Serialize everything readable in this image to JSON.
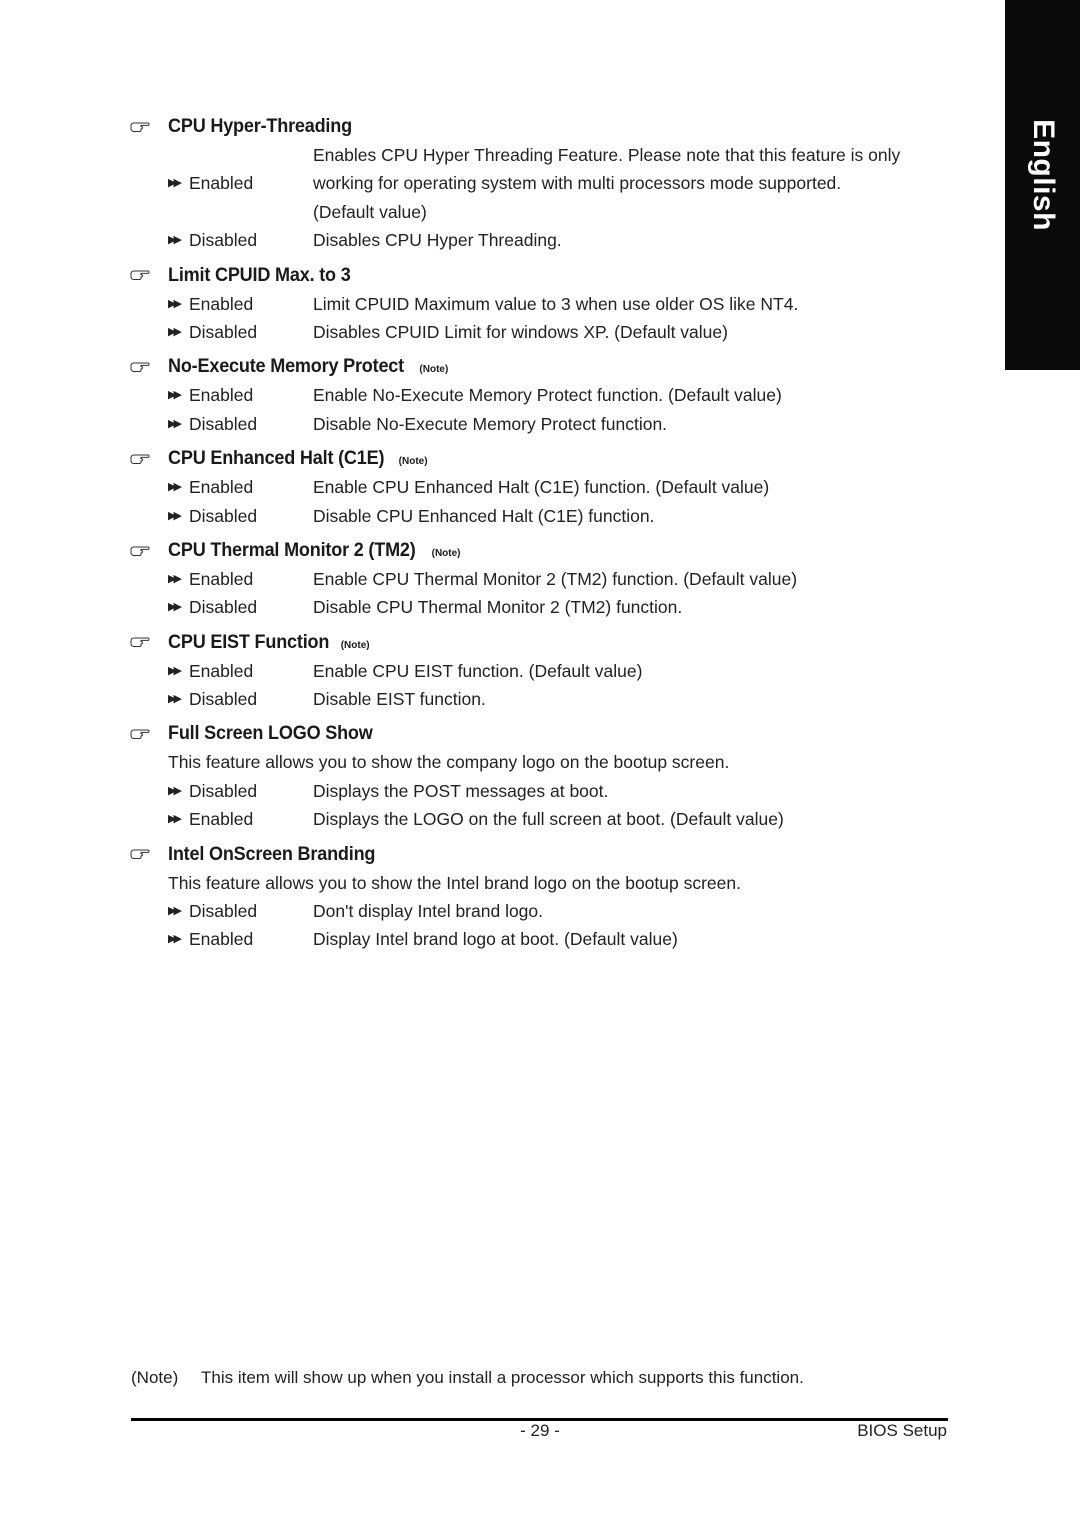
{
  "side_tab": {
    "label": "English"
  },
  "sections": [
    {
      "title": "CPU Hyper-Threading",
      "note_mark": "",
      "intro": "",
      "options": [
        {
          "label": "Enabled",
          "desc": [
            "Enables CPU Hyper Threading Feature. Please note that this feature is only",
            "working for operating system with multi processors mode supported.",
            "(Default value)"
          ]
        },
        {
          "label": "Disabled",
          "desc": [
            "Disables CPU Hyper Threading."
          ]
        }
      ]
    },
    {
      "title": "Limit CPUID Max. to 3",
      "note_mark": "",
      "intro": "",
      "options": [
        {
          "label": "Enabled",
          "desc": [
            "Limit CPUID Maximum value to 3 when use older OS like NT4."
          ]
        },
        {
          "label": "Disabled",
          "desc": [
            "Disables CPUID Limit for windows XP. (Default value)"
          ]
        }
      ]
    },
    {
      "title": "No-Execute Memory Protect",
      "note_mark": "(Note)",
      "intro": "",
      "options": [
        {
          "label": "Enabled",
          "desc": [
            "Enable No-Execute Memory Protect function. (Default value)"
          ]
        },
        {
          "label": "Disabled",
          "desc": [
            "Disable No-Execute Memory Protect function."
          ]
        }
      ]
    },
    {
      "title": "CPU Enhanced Halt (C1E)",
      "note_mark": "(Note)",
      "intro": "",
      "options": [
        {
          "label": "Enabled",
          "desc": [
            "Enable CPU Enhanced Halt (C1E) function. (Default value)"
          ]
        },
        {
          "label": "Disabled",
          "desc": [
            "Disable CPU Enhanced Halt (C1E) function."
          ]
        }
      ]
    },
    {
      "title": "CPU Thermal Monitor 2 (TM2)",
      "note_mark": "(Note)",
      "intro": "",
      "options": [
        {
          "label": "Enabled",
          "desc": [
            "Enable CPU Thermal Monitor 2 (TM2) function. (Default value)"
          ]
        },
        {
          "label": "Disabled",
          "desc": [
            "Disable CPU Thermal Monitor 2 (TM2) function."
          ]
        }
      ]
    },
    {
      "title": "CPU EIST Function",
      "note_mark": "(Note)",
      "intro": "",
      "options": [
        {
          "label": "Enabled",
          "desc": [
            "Enable CPU EIST function. (Default value)"
          ]
        },
        {
          "label": "Disabled",
          "desc": [
            "Disable EIST function."
          ]
        }
      ]
    },
    {
      "title": "Full Screen LOGO Show",
      "note_mark": "",
      "intro": "This feature allows you to show the company logo on the bootup screen.",
      "options": [
        {
          "label": "Disabled",
          "desc": [
            "Displays the POST messages at boot."
          ]
        },
        {
          "label": "Enabled",
          "desc": [
            "Displays the LOGO on the full screen at boot. (Default value)"
          ]
        }
      ]
    },
    {
      "title": "Intel OnScreen Branding",
      "note_mark": "",
      "intro": "This feature allows you to show the Intel brand logo on the bootup screen.",
      "options": [
        {
          "label": "Disabled",
          "desc": [
            "Don't display Intel brand logo."
          ]
        },
        {
          "label": "Enabled",
          "desc": [
            "Display Intel brand logo at boot. (Default value)"
          ]
        }
      ]
    }
  ],
  "footnote": {
    "label": "(Note)",
    "text": "This item will show up when you install a processor which supports this function."
  },
  "footer": {
    "page_number": "- 29 -",
    "section_name": "BIOS Setup"
  }
}
